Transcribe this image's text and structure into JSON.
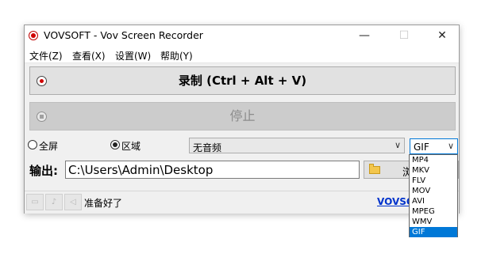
{
  "window": {
    "title": "VOVSOFT - Vov Screen Recorder",
    "controls": {
      "minimize": "—",
      "maximize": "☐",
      "close": "✕"
    }
  },
  "menu": [
    "文件(Z)",
    "查看(X)",
    "设置(W)",
    "帮助(Y)"
  ],
  "record_button": {
    "label": "录制 (Ctrl + Alt + V)"
  },
  "stop_button": {
    "label": "停止",
    "enabled": false
  },
  "capture_mode": {
    "fullscreen_label": "全屏",
    "region_label": "区域",
    "selected": "区域"
  },
  "audio_select": {
    "value": "无音频"
  },
  "format_select": {
    "value": "GIF",
    "options": [
      "MP4",
      "MKV",
      "FLV",
      "MOV",
      "AVI",
      "MPEG",
      "WMV",
      "GIF"
    ],
    "highlighted": "GIF"
  },
  "output": {
    "label": "输出:",
    "path": "C:\\Users\\Admin\\Desktop",
    "browse_label": "浏"
  },
  "status": {
    "text": "准备好了",
    "link": "VOVSO"
  },
  "icons": {
    "camera": "camera-icon",
    "microphone": "microphone-icon",
    "speaker": "speaker-icon",
    "folder": "folder-icon"
  },
  "colors": {
    "accent": "#0078d7",
    "record_red": "#d00000",
    "link": "#0033cc"
  }
}
